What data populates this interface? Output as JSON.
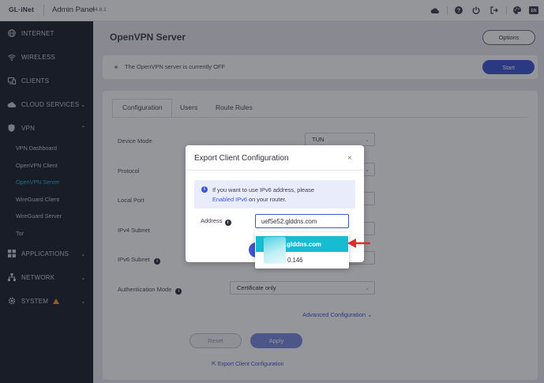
{
  "header": {
    "logo": "GL·iNet",
    "title": "Admin Panel",
    "version": "v4.8.1",
    "icons": [
      "cloud-icon",
      "help-icon",
      "power-icon",
      "logout-icon",
      "theme-icon",
      "language-icon"
    ],
    "language": "EN"
  },
  "sidebar": {
    "items": [
      {
        "label": "INTERNET",
        "icon": "globe-icon"
      },
      {
        "label": "WIRELESS",
        "icon": "wifi-icon"
      },
      {
        "label": "CLIENTS",
        "icon": "clients-icon"
      },
      {
        "label": "CLOUD SERVICES",
        "icon": "cloud-icon",
        "chevron": "⌄"
      },
      {
        "label": "VPN",
        "icon": "shield-icon",
        "chevron": "⌃"
      },
      {
        "label": "APPLICATIONS",
        "icon": "apps-icon",
        "chevron": "⌄"
      },
      {
        "label": "NETWORK",
        "icon": "network-icon",
        "chevron": "⌄"
      },
      {
        "label": "SYSTEM",
        "icon": "gear-icon",
        "chevron": "⌄"
      }
    ],
    "vpn_sub": [
      "VPN Dashboard",
      "OpenVPN Client",
      "OpenVPN Server",
      "WireGuard Client",
      "WireGuard Server",
      "Tor"
    ],
    "active_sub": "OpenVPN Server",
    "accent_color": "#27b6d4"
  },
  "main": {
    "title": "OpenVPN Server",
    "options_label": "Options",
    "status_text": "The OpenVPN server is currently OFF",
    "start_label": "Start",
    "tabs": [
      "Configuration",
      "Users",
      "Route Rules"
    ],
    "fields": [
      {
        "label": "Device Mode",
        "value": "TUN"
      },
      {
        "label": "Protocol",
        "value": ""
      },
      {
        "label": "Local Port",
        "value": ""
      },
      {
        "label": "IPv4 Subnet",
        "value": ""
      },
      {
        "label": "IPv6 Subnet",
        "value": ""
      },
      {
        "label": "Authentication Mode",
        "value": "Certificate only"
      }
    ],
    "advanced_label": "Advanced Configuration",
    "reset_label": "Reset",
    "apply_label": "Apply",
    "export_label": "Export Client Configuration",
    "primary_color": "#3d56d1"
  },
  "modal": {
    "title": "Export Client Configuration",
    "close": "×",
    "info_prefix": "If you want to use IPv6 address, please",
    "info_link": "Enabled IPv6",
    "info_suffix": "on your router.",
    "address_label": "Address",
    "address_value": "uef5e52.glddns.com",
    "dropdown_options": [
      ".glddns.com",
      "0.146"
    ],
    "highlight_color": "#18bcd0"
  }
}
